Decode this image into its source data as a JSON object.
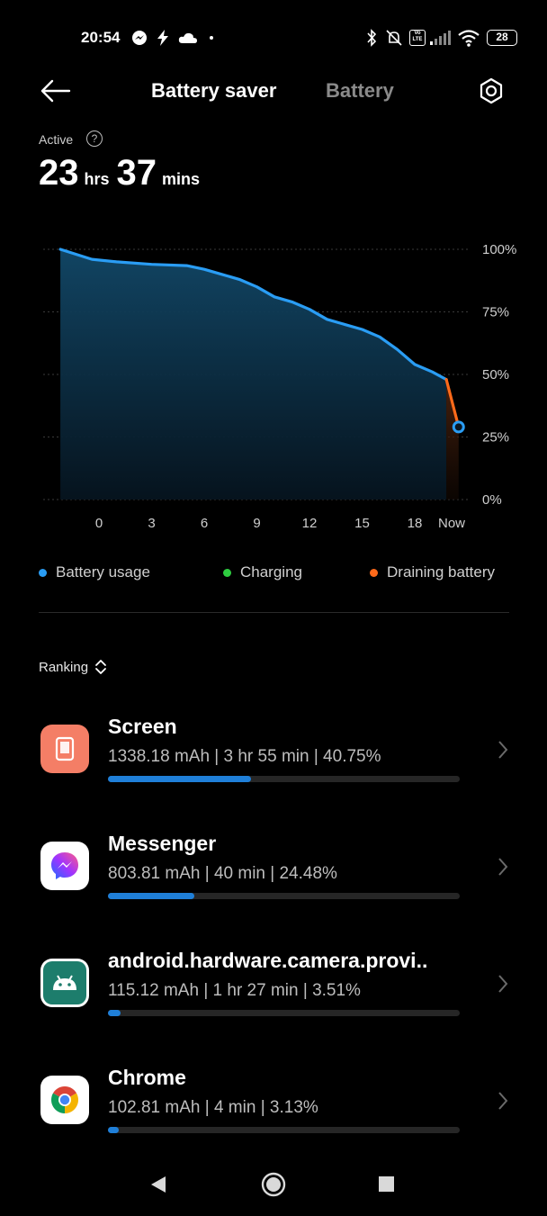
{
  "status_bar": {
    "time": "20:54",
    "battery_level": "28",
    "icons": [
      "messenger-icon",
      "bolt-icon",
      "cloud-icon",
      "dot-icon",
      "bluetooth-icon",
      "mute-icon",
      "volte-icon",
      "signal-icon",
      "wifi-icon",
      "battery-icon"
    ]
  },
  "header": {
    "title": "Battery saver",
    "tab": "Battery"
  },
  "summary": {
    "label": "Active",
    "hours": "23",
    "hours_unit": "hrs",
    "minutes": "37",
    "minutes_unit": "mins"
  },
  "chart_data": {
    "type": "area",
    "y_ticks": [
      "100%",
      "75%",
      "50%",
      "25%",
      "0%"
    ],
    "x_ticks": [
      "0",
      "3",
      "6",
      "9",
      "12",
      "15",
      "18",
      "Now"
    ],
    "ylim": [
      0,
      100
    ],
    "series": [
      {
        "name": "Battery usage",
        "color": "#2a9df4",
        "x": [
          -2.2,
          -0.4,
          1,
          3,
          5,
          6,
          7,
          8,
          9,
          10,
          11,
          12,
          13,
          14,
          15,
          16,
          17,
          18,
          19,
          19.8
        ],
        "y": [
          100,
          96,
          95,
          94,
          93.5,
          92,
          90,
          88,
          85,
          81,
          79,
          76,
          72,
          70,
          68,
          65,
          60,
          54,
          51,
          48
        ]
      },
      {
        "name": "Draining battery",
        "color": "#ff6a1a",
        "x": [
          19.8,
          20.5
        ],
        "y": [
          48,
          29
        ]
      }
    ],
    "current_point": {
      "x": 20.5,
      "y": 29
    }
  },
  "legend": [
    {
      "label": "Battery usage",
      "color": "#2a9df4"
    },
    {
      "label": "Charging",
      "color": "#2ecc40"
    },
    {
      "label": "Draining battery",
      "color": "#ff6a1a"
    }
  ],
  "ranking_label": "Ranking",
  "apps": [
    {
      "name": "Screen",
      "stats": "1338.18 mAh | 3 hr 55 min  | 40.75%",
      "share": 0.4075,
      "icon": "screen-icon"
    },
    {
      "name": "Messenger",
      "stats": "803.81 mAh | 40 min  | 24.48%",
      "share": 0.2448,
      "icon": "messenger-icon"
    },
    {
      "name": "android.hardware.camera.provi..",
      "stats": "115.12 mAh | 1 hr 27 min  | 3.51%",
      "share": 0.0351,
      "icon": "android-icon"
    },
    {
      "name": "Chrome",
      "stats": "102.81 mAh | 4 min  | 3.13%",
      "share": 0.0313,
      "icon": "chrome-icon"
    }
  ]
}
